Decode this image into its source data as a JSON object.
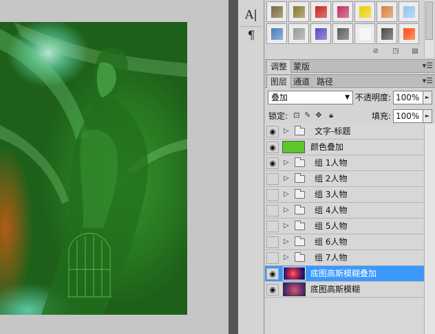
{
  "swatches": [
    {
      "name": "swatch-brown-bevel",
      "color": "#7a6a3a"
    },
    {
      "name": "swatch-olive-gradient",
      "color": "#8a7a30"
    },
    {
      "name": "swatch-red-striped",
      "color": "#cc2222"
    },
    {
      "name": "swatch-multicolor-rays",
      "color": "#c03060"
    },
    {
      "name": "swatch-yellow-frame",
      "color": "#e8d000"
    },
    {
      "name": "swatch-orange-gradient",
      "color": "#d88040"
    },
    {
      "name": "swatch-light-blue",
      "color": "#8ec4f0"
    },
    {
      "name": "swatch-sky-landscape",
      "color": "#4a80c0"
    },
    {
      "name": "swatch-sparkle-texture",
      "color": "#9a9a9a"
    },
    {
      "name": "swatch-purple-glow",
      "color": "#5a4ac0"
    },
    {
      "name": "swatch-dark-gray",
      "color": "#5c5c5c"
    },
    {
      "name": "swatch-white-square",
      "color": "#f4f4f4"
    },
    {
      "name": "swatch-charcoal",
      "color": "#4a4a4a"
    },
    {
      "name": "swatch-orange-burst",
      "color": "#ff5010"
    }
  ],
  "adjust_tabs": {
    "tab1": "调整",
    "tab2": "蒙版"
  },
  "layers_tabs": {
    "tab1": "图层",
    "tab2": "通道",
    "tab3": "路径"
  },
  "blend": {
    "mode": "叠加",
    "opacity_label": "不透明度:",
    "opacity": "100%",
    "lock_label": "锁定:",
    "fill_label": "填充:",
    "fill": "100%"
  },
  "layers": [
    {
      "name": "文字-标题",
      "kind": "group",
      "visible": true
    },
    {
      "name": "颜色叠加",
      "kind": "fill",
      "visible": true,
      "color": "#5cc82a"
    },
    {
      "name": "组 1人物",
      "kind": "group",
      "visible": true
    },
    {
      "name": "组 2人物",
      "kind": "group",
      "visible": false
    },
    {
      "name": "组 3人物",
      "kind": "group",
      "visible": false
    },
    {
      "name": "组 4人物",
      "kind": "group",
      "visible": false
    },
    {
      "name": "组 5人物",
      "kind": "group",
      "visible": false
    },
    {
      "name": "组 6人物",
      "kind": "group",
      "visible": false
    },
    {
      "name": "组 7人物",
      "kind": "group",
      "visible": false
    },
    {
      "name": "底图高斯模糊叠加",
      "kind": "image",
      "visible": true,
      "selected": true
    },
    {
      "name": "底图高斯模糊",
      "kind": "image",
      "visible": true
    }
  ],
  "icons": {
    "eye": "eye-icon",
    "folder": "folder-icon",
    "expand": "triangle-right-icon"
  },
  "colors": {
    "selection": "#3b99fc",
    "panel": "#d4d4d4",
    "separator": "#555555"
  }
}
